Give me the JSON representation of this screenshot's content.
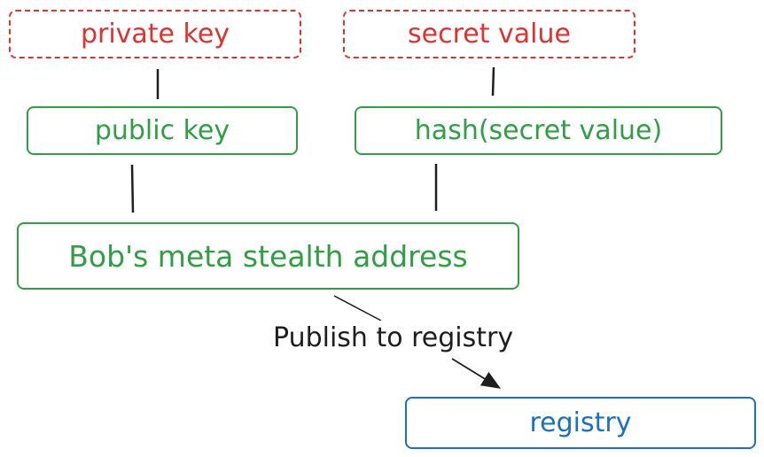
{
  "diagram": {
    "nodes": {
      "private_key": "private key",
      "secret_value": "secret value",
      "public_key": "public key",
      "hash_secret": "hash(secret value)",
      "meta_address": "Bob's meta stealth address",
      "registry": "registry"
    },
    "edge_label": "Publish to registry",
    "colors": {
      "red": "#e03131",
      "green": "#2f9e44",
      "blue": "#1971c2",
      "text": "#1e1e1e"
    }
  }
}
